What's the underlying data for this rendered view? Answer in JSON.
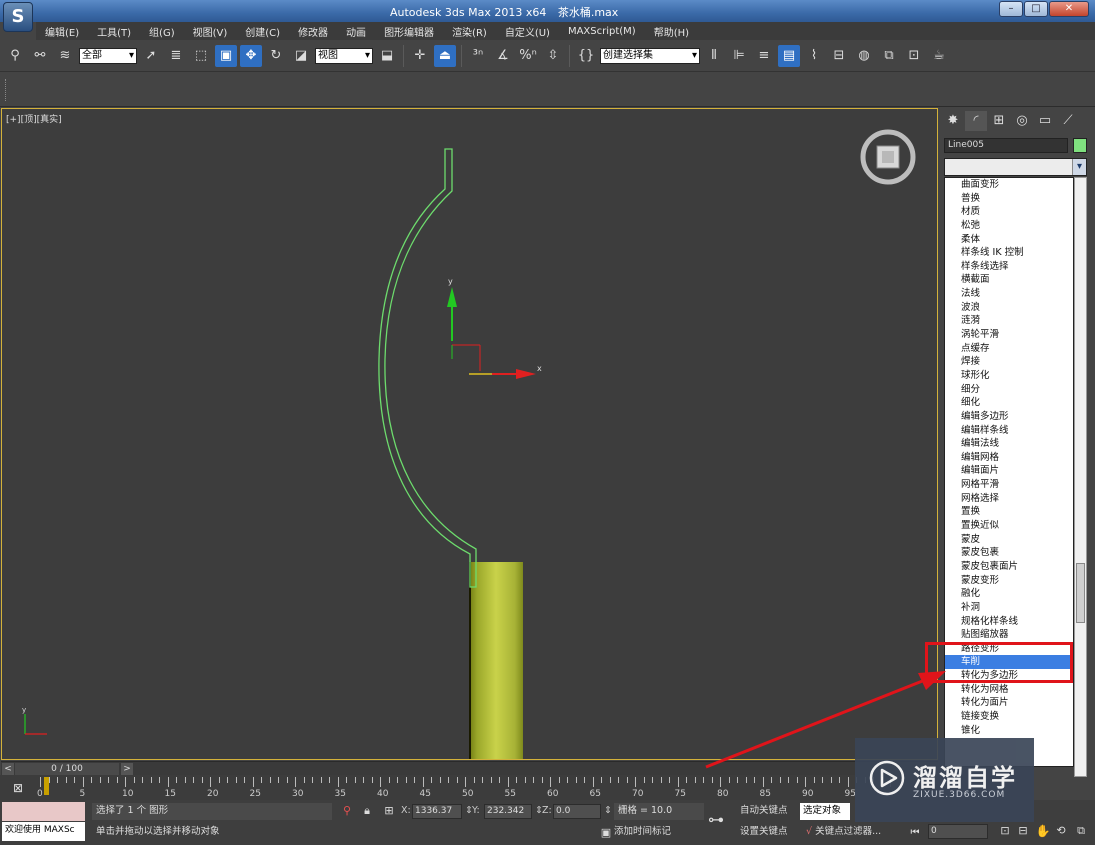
{
  "window": {
    "title_app": "Autodesk 3ds Max  2013 x64",
    "title_file": "茶水桶.max",
    "minimize": "–",
    "maximize": "□",
    "close": "✕"
  },
  "menu": [
    "编辑(E)",
    "工具(T)",
    "组(G)",
    "视图(V)",
    "创建(C)",
    "修改器",
    "动画",
    "图形编辑器",
    "渲染(R)",
    "自定义(U)",
    "MAXScript(M)",
    "帮助(H)"
  ],
  "toolbar": {
    "selection_filter": "全部",
    "ref_coord": "视图",
    "named_selection": "创建选择集"
  },
  "viewport": {
    "label": "[+][顶][真实]",
    "x_axis_label": "x",
    "y_axis_label": "y"
  },
  "command_panel": {
    "object_name": "Line005",
    "modifiers": [
      "曲面变形",
      "普换",
      "材质",
      "松弛",
      "柔体",
      "样条线 IK 控制",
      "样条线选择",
      "横截面",
      "法线",
      "波浪",
      "涟漪",
      "涡轮平滑",
      "点缓存",
      "焊接",
      "球形化",
      "细分",
      "细化",
      "编辑多边形",
      "编辑样条线",
      "编辑法线",
      "编辑网格",
      "编辑面片",
      "网格平滑",
      "网格选择",
      "置换",
      "置换近似",
      "蒙皮",
      "蒙皮包裹",
      "蒙皮包裹面片",
      "蒙皮变形",
      "融化",
      "补洞",
      "规格化样条线",
      "贴图缩放器",
      "路径变形",
      "车削",
      "转化为多边形",
      "转化为网格",
      "转化为面片",
      "链接变换",
      "锥化"
    ],
    "selected_modifier": "车削",
    "colors": {
      "object_color": "#7fe07f",
      "selection": "#3b7ee2"
    }
  },
  "timeline": {
    "frame_display": "0 / 100",
    "prev": "<",
    "next": ">",
    "ticks": [
      "0",
      "5",
      "10",
      "15",
      "20",
      "25",
      "30",
      "35",
      "40",
      "45",
      "50",
      "55",
      "60",
      "65",
      "70",
      "75",
      "80",
      "85",
      "90",
      "95"
    ]
  },
  "status": {
    "maxscript_welcome": "欢迎使用 MAXSc",
    "selected_text": "选择了 1 个 图形",
    "prompt_text": "单击并拖动以选择并移动对象",
    "x_label": "X:",
    "x_value": "1336.37",
    "y_label": "Y:",
    "y_value": "232.342",
    "z_label": "Z:",
    "z_value": "0.0",
    "grid": "栅格 = 10.0",
    "add_time_tag": "添加时间标记",
    "auto_key": "自动关键点",
    "set_key": "设置关键点",
    "selection_mode": "选定对象",
    "key_filters": "关键点过滤器...",
    "current_frame": "0"
  },
  "watermark": {
    "title": "溜溜自学",
    "subtitle": "ZIXUE.3D66.COM"
  }
}
